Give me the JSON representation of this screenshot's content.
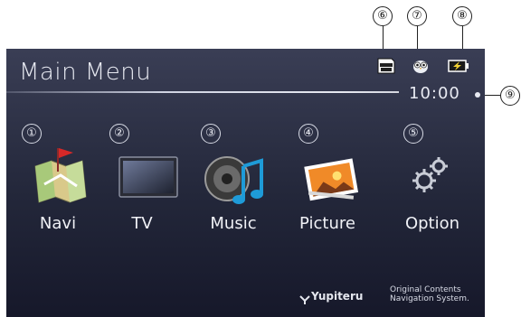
{
  "screen": {
    "title": "Main Menu",
    "clock": "10:00"
  },
  "status_icons": [
    {
      "name": "micro-sd-card-icon",
      "callout": "⑥"
    },
    {
      "name": "owl-icon",
      "callout": "⑦"
    },
    {
      "name": "battery-charging-icon",
      "callout": "⑧"
    }
  ],
  "clock_callout": "⑨",
  "menu": {
    "items": [
      {
        "label": "Navi",
        "callout": "①",
        "icon": "map-icon"
      },
      {
        "label": "TV",
        "callout": "②",
        "icon": "tv-icon"
      },
      {
        "label": "Music",
        "callout": "③",
        "icon": "music-icon"
      },
      {
        "label": "Picture",
        "callout": "④",
        "icon": "picture-icon"
      },
      {
        "label": "Option",
        "callout": "⑤",
        "icon": "gears-icon"
      }
    ]
  },
  "footer": {
    "brand": "Yupiteru",
    "brand_line1": "Original Contents",
    "brand_line2": "Navigation System."
  },
  "colors": {
    "screen_top": "#3a3e55",
    "screen_bottom": "#16182a",
    "text": "#e8eaf2",
    "battery": "#f2d233"
  }
}
